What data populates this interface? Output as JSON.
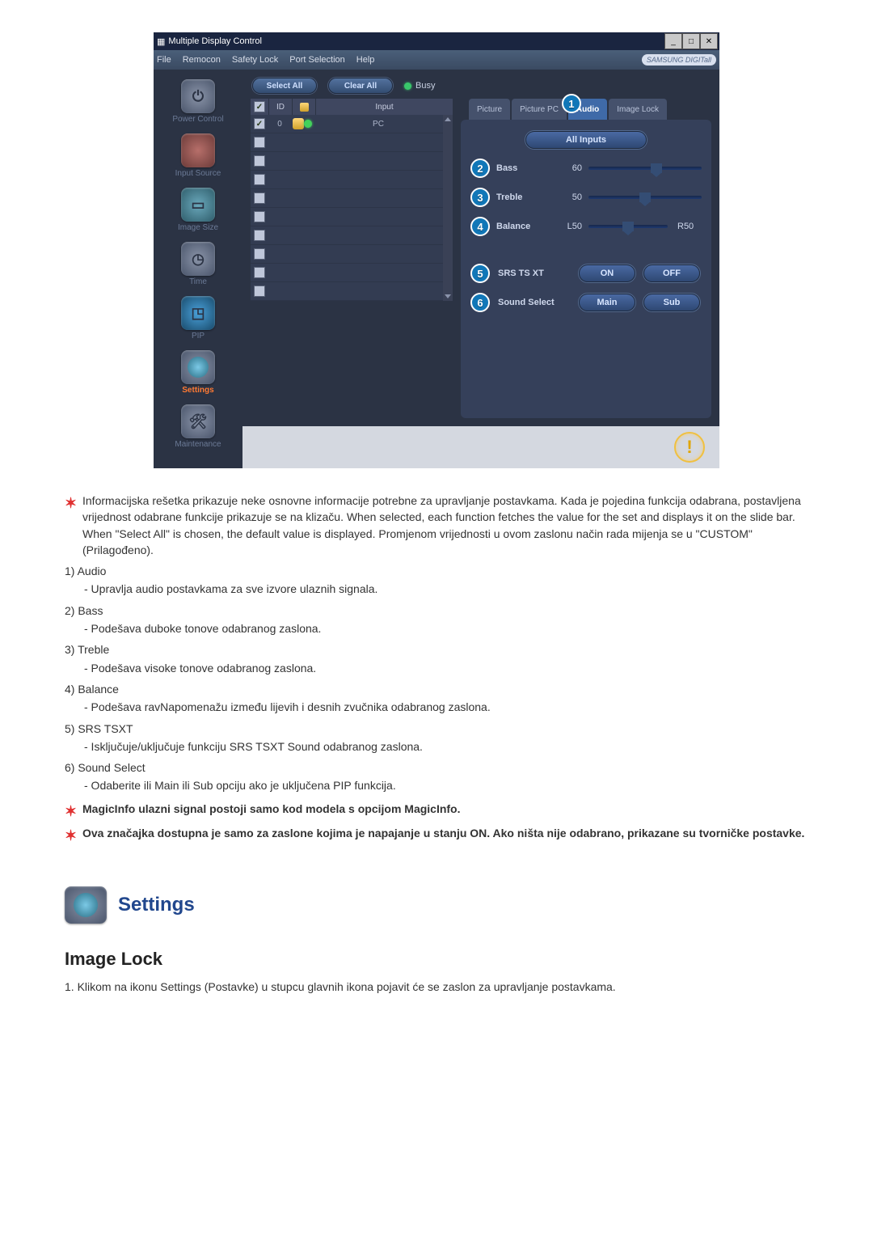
{
  "window": {
    "title": "Multiple Display Control",
    "menus": [
      "File",
      "Remocon",
      "Safety Lock",
      "Port Selection",
      "Help"
    ],
    "brand": "SAMSUNG DIGITall"
  },
  "sidebar": {
    "items": [
      {
        "label": "Power Control"
      },
      {
        "label": "Input Source"
      },
      {
        "label": "Image Size"
      },
      {
        "label": "Time"
      },
      {
        "label": "PIP"
      },
      {
        "label": "Settings"
      },
      {
        "label": "Maintenance"
      }
    ]
  },
  "toolbar": {
    "select_all": "Select All",
    "clear_all": "Clear All",
    "busy": "Busy"
  },
  "table": {
    "headers": {
      "id": "ID",
      "input": "Input"
    },
    "rows": [
      {
        "id": "0",
        "input": "PC",
        "on": true
      },
      {
        "on": false
      },
      {
        "on": false
      },
      {
        "on": false
      },
      {
        "on": false
      },
      {
        "on": false
      },
      {
        "on": false
      },
      {
        "on": false
      },
      {
        "on": false
      },
      {
        "on": false
      }
    ]
  },
  "panel": {
    "tabs": {
      "picture": "Picture",
      "picture_pc": "Picture PC",
      "audio": "Audio",
      "image_lock": "Image Lock"
    },
    "all_inputs": "All Inputs",
    "bass": {
      "label": "Bass",
      "value": "60",
      "pct": 60
    },
    "treble": {
      "label": "Treble",
      "value": "50",
      "pct": 50
    },
    "balance": {
      "label": "Balance",
      "val_left": "L50",
      "val_right": "R50",
      "pct": 50
    },
    "srs": {
      "label": "SRS TS XT",
      "on": "ON",
      "off": "OFF"
    },
    "sound_select": {
      "label": "Sound Select",
      "main": "Main",
      "sub": "Sub"
    }
  },
  "content": {
    "intro": "Informacijska rešetka prikazuje neke osnovne informacije potrebne za upravljanje postavkama. Kada je pojedina funkcija odabrana, postavljena vrijednost odabrane funkcije prikazuje se na klizaču. When selected, each function fetches the value for the set and displays it on the slide bar. When \"Select All\" is chosen, the default value is displayed. Promjenom vrijednosti u ovom zaslonu način rada mijenja se u \"CUSTOM\" (Prilagođeno).",
    "items": [
      {
        "n": "1)",
        "t": "Audio",
        "sub": "- Upravlja audio postavkama za sve izvore ulaznih signala."
      },
      {
        "n": "2)",
        "t": "Bass",
        "sub": "- Podešava duboke tonove odabranog zaslona."
      },
      {
        "n": "3)",
        "t": "Treble",
        "sub": "- Podešava visoke tonove odabranog zaslona."
      },
      {
        "n": "4)",
        "t": "Balance",
        "sub": "- Podešava ravNapomenažu između lijevih i desnih zvučnika odabranog zaslona."
      },
      {
        "n": "5)",
        "t": "SRS TSXT",
        "sub": "- Isključuje/uključuje funkciju SRS TSXT Sound odabranog zaslona."
      },
      {
        "n": "6)",
        "t": "Sound Select",
        "sub": "- Odaberite ili Main ili Sub opciju ako je uključena PIP funkcija."
      }
    ],
    "note1": "MagicInfo ulazni signal postoji samo kod modela s opcijom MagicInfo.",
    "note2": "Ova značajka dostupna je samo za zaslone kojima je napajanje u stanju ON. Ako ništa nije odabrano, prikazane su tvorničke postavke.",
    "settings_title": "Settings",
    "h2": "Image Lock",
    "step1": "1.  Klikom na ikonu Settings (Postavke) u stupcu glavnih ikona pojavit će se zaslon za upravljanje postavkama."
  },
  "badges": {
    "b1": "1",
    "b2": "2",
    "b3": "3",
    "b4": "4",
    "b5": "5",
    "b6": "6"
  }
}
